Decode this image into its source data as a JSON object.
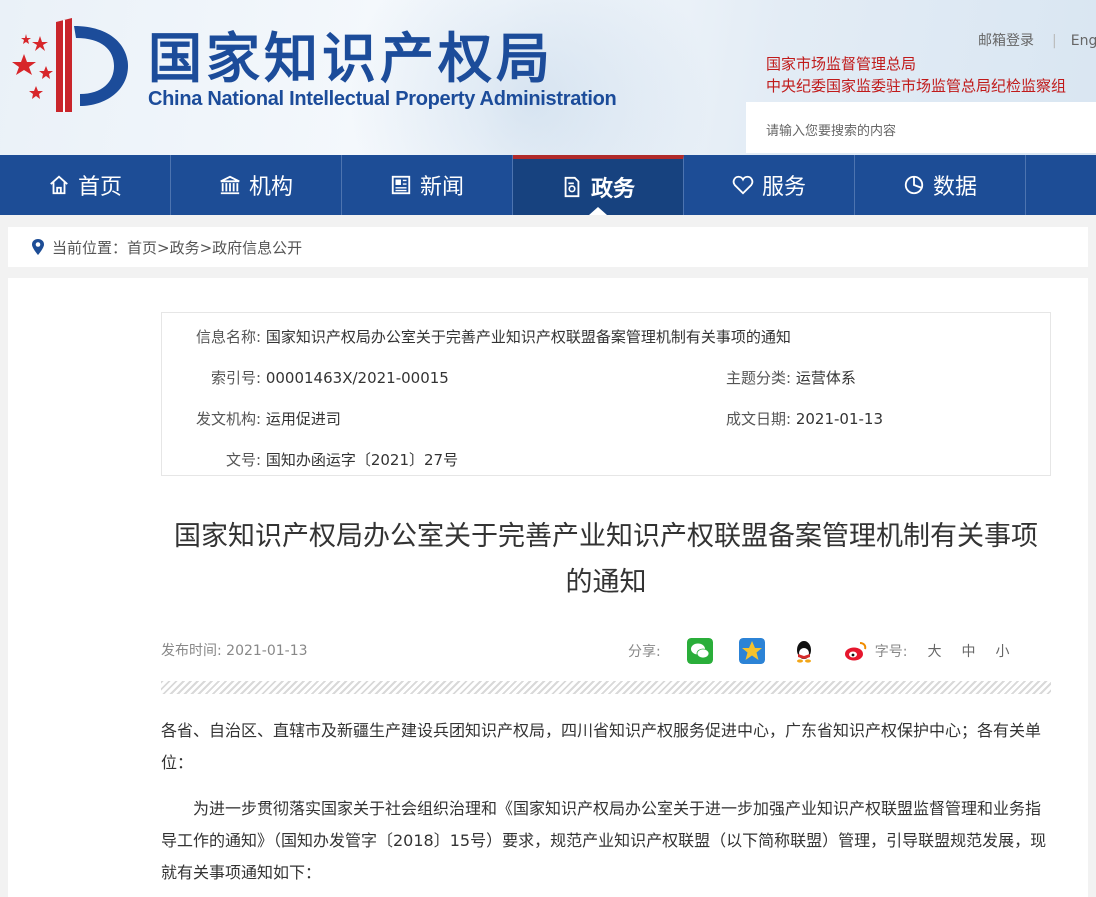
{
  "header": {
    "logo_cn": "国家知识产权局",
    "logo_en": "China National Intellectual Property Administration",
    "top_links": [
      "邮箱登录",
      "Eng"
    ],
    "supervisor_links": [
      "国家市场监督管理总局",
      "中央纪委国家监委驻市场监管总局纪检监察组"
    ],
    "search_placeholder": "请输入您要搜索的内容"
  },
  "nav": {
    "items": [
      {
        "label": "首页",
        "icon": "home-icon"
      },
      {
        "label": "机构",
        "icon": "institution-icon"
      },
      {
        "label": "新闻",
        "icon": "news-icon"
      },
      {
        "label": "政务",
        "icon": "government-icon",
        "active": true
      },
      {
        "label": "服务",
        "icon": "service-icon"
      },
      {
        "label": "数据",
        "icon": "data-icon"
      }
    ]
  },
  "breadcrumb": {
    "prefix": "当前位置：",
    "path": "首页>政务>政府信息公开"
  },
  "info": {
    "name_label": "信息名称:",
    "name_value": "国家知识产权局办公室关于完善产业知识产权联盟备案管理机制有关事项的通知",
    "index_label": "索引号:",
    "index_value": "00001463X/2021-00015",
    "topic_label": "主题分类:",
    "topic_value": "运营体系",
    "org_label": "发文机构:",
    "org_value": "运用促进司",
    "date_label": "成文日期:",
    "date_value": "2021-01-13",
    "docno_label": "文号:",
    "docno_value": "国知办函运字〔2021〕27号"
  },
  "article": {
    "title": "国家知识产权局办公室关于完善产业知识产权联盟备案管理机制有关事项的通知",
    "publish_label": "发布时间:",
    "publish_date": "2021-01-13",
    "share_label": "分享:",
    "font_label": "字号:",
    "font_sizes": [
      "大",
      "中",
      "小"
    ],
    "paragraph1": "各省、自治区、直辖市及新疆生产建设兵团知识产权局，四川省知识产权服务促进中心，广东省知识产权保护中心；各有关单位：",
    "paragraph2": "为进一步贯彻落实国家关于社会组织治理和《国家知识产权局办公室关于进一步加强产业知识产权联盟监督管理和业务指导工作的通知》（国知办发管字〔2018〕15号）要求，规范产业知识产权联盟（以下简称联盟）管理，引导联盟规范发展，现就有关事项通知如下："
  },
  "colors": {
    "brand_blue": "#1d4d96",
    "nav_active": "#17427f",
    "accent_red": "#c01a1a"
  }
}
